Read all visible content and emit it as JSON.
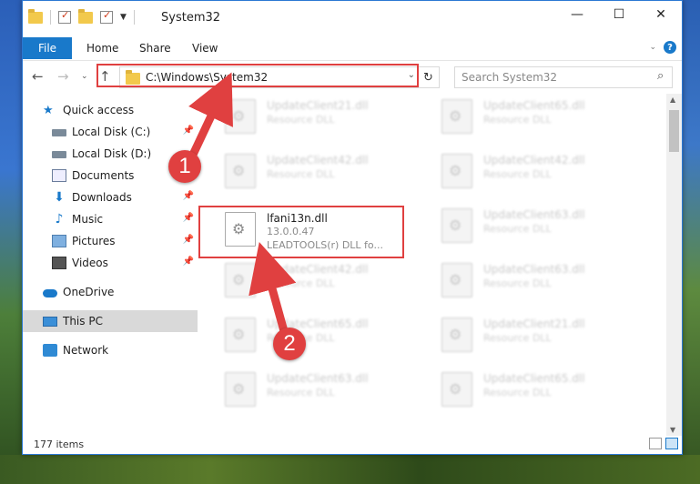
{
  "window": {
    "title": "System32",
    "controls": [
      "—",
      "☐",
      "✕"
    ]
  },
  "ribbon": {
    "tabs": [
      "File",
      "Home",
      "Share",
      "View"
    ],
    "help_label": "?"
  },
  "address": {
    "path": "C:\\Windows\\System32",
    "search_placeholder": "Search System32"
  },
  "nav": {
    "items": [
      {
        "label": "Quick access",
        "pinned": false
      },
      {
        "label": "Local Disk (C:)",
        "pinned": true
      },
      {
        "label": "Local Disk (D:)",
        "pinned": false
      },
      {
        "label": "Documents",
        "pinned": true
      },
      {
        "label": "Downloads",
        "pinned": true
      },
      {
        "label": "Music",
        "pinned": true
      },
      {
        "label": "Pictures",
        "pinned": true
      },
      {
        "label": "Videos",
        "pinned": true
      },
      {
        "label": "OneDrive",
        "pinned": false
      },
      {
        "label": "This PC",
        "pinned": false,
        "selected": true
      },
      {
        "label": "Network",
        "pinned": false
      }
    ]
  },
  "files": {
    "left": [
      {
        "name": "UpdateClient21.dll",
        "type": "Resource DLL"
      },
      {
        "name": "UpdateClient42.dll",
        "type": "Resource DLL"
      },
      {
        "name": "lfani13n.dll",
        "type": "13.0.0.47",
        "desc": "LEADTOOLS(r) DLL fo..."
      },
      {
        "name": "UpdateClient42.dll",
        "type": "Resource DLL"
      },
      {
        "name": "UpdateClient65.dll",
        "type": "Resource DLL"
      },
      {
        "name": "UpdateClient63.dll",
        "type": "Resource DLL"
      }
    ],
    "right": [
      {
        "name": "UpdateClient65.dll",
        "type": "Resource DLL"
      },
      {
        "name": "UpdateClient42.dll",
        "type": "Resource DLL"
      },
      {
        "name": "UpdateClient63.dll",
        "type": "Resource DLL"
      },
      {
        "name": "UpdateClient63.dll",
        "type": "Resource DLL"
      },
      {
        "name": "UpdateClient21.dll",
        "type": "Resource DLL"
      },
      {
        "name": "UpdateClient65.dll",
        "type": "Resource DLL"
      }
    ]
  },
  "status": {
    "item_count": "177 items"
  },
  "annotations": {
    "step1": "1",
    "step2": "2"
  },
  "colors": {
    "accent": "#1979ca",
    "highlight": "#e04040"
  }
}
